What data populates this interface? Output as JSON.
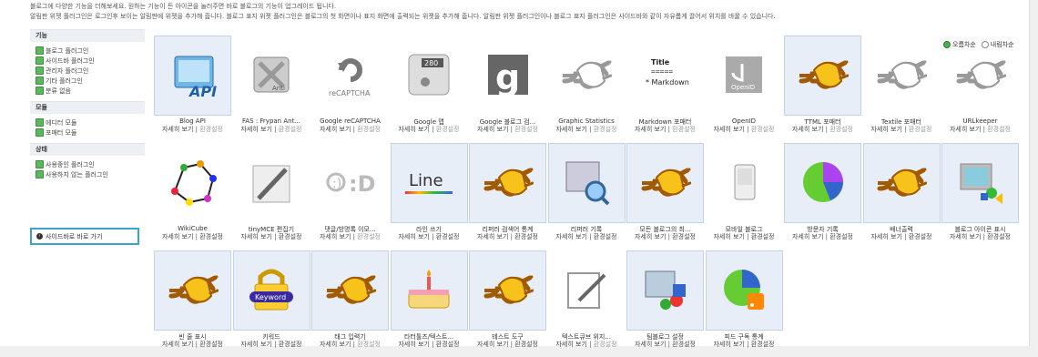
{
  "description": {
    "line1": "블로그에 다양한 기능을 더해보세요. 원하는 기능이 든 아이콘을 눌러주면 바로 블로그의 기능이 업그레이드 됩니다.",
    "line2": "알림판 위젯 플러그인은 로그인후 보이는 알림판에 위젯을 추가해 줍니다. 블로그 표지 위젯 플러그인은 블로그의 첫 화면이나 표지 화면에 출력되는 위젯을 추가해 줍니다. 알림판 위젯 플러그인이나 블로그 표지 플러그인은 사이드바와 같이 자유롭게 끌어서 위치를 바꿀 수 있습니다."
  },
  "sidebar": {
    "sections": [
      {
        "title": "기능",
        "items": [
          "블로그 플러그인",
          "사이드바 플러그인",
          "관리자 플러그인",
          "기타 플러그인",
          "분류 없음"
        ]
      },
      {
        "title": "모듈",
        "items": [
          "에디터 모듈",
          "포매터 모듈"
        ]
      },
      {
        "title": "상태",
        "items": [
          "사용중인 플러그인",
          "사용하지 않는 플러그인"
        ]
      }
    ],
    "jump_label": "사이드바로 바로 가기"
  },
  "sort": {
    "ascending": "오름차순",
    "descending": "내림차순",
    "selected": "ascending"
  },
  "action_labels": {
    "detail": "자세히 보기",
    "sep": " | ",
    "settings": "환경설정"
  },
  "plugins": [
    {
      "name": "Blog API",
      "icon": "api-icon",
      "active": true,
      "settings_active": false
    },
    {
      "name": "FAS : Frypan Ant...",
      "icon": "anti-spam-icon",
      "active": false,
      "settings_active": false
    },
    {
      "name": "Google reCAPTCHA",
      "icon": "recaptcha-icon",
      "caption": "reCAPTCHA",
      "active": false,
      "settings_active": false
    },
    {
      "name": "Google 맵",
      "icon": "google-map-icon",
      "caption": "280",
      "active": false,
      "settings_active": false
    },
    {
      "name": "Google 블로그 검...",
      "icon": "google-logo-icon",
      "active": false,
      "settings_active": false
    },
    {
      "name": "Graphic Statistics",
      "icon": "plug-icon-gray",
      "active": false,
      "settings_active": false
    },
    {
      "name": "Markdown 포매터",
      "icon": "markdown-icon",
      "md_title": "Title",
      "md_rule": "=====",
      "md_text": "* Markdown",
      "active": false,
      "settings_active": false
    },
    {
      "name": "OpenID",
      "icon": "openid-icon",
      "caption": "OpenID",
      "active": false,
      "settings_active": false
    },
    {
      "name": "TTML 포매터",
      "icon": "plug-icon-yellow",
      "active": true,
      "settings_active": false
    },
    {
      "name": "Textile 포매터",
      "icon": "plug-icon-gray",
      "active": false,
      "settings_active": false
    },
    {
      "name": "URLkeeper",
      "icon": "plug-icon-gray",
      "active": false,
      "settings_active": false
    },
    {
      "name": "WikiCube",
      "icon": "network-icon",
      "active": false,
      "settings_active": true
    },
    {
      "name": "tinyMCE 편집기",
      "icon": "pen-icon",
      "active": false,
      "settings_active": true
    },
    {
      "name": "댓글/방명록 이모...",
      "icon": "emoticon-icon",
      "active": false,
      "settings_active": false
    },
    {
      "name": "라인 쓰기",
      "icon": "line-icon",
      "caption": "Line",
      "active": true,
      "settings_active": true
    },
    {
      "name": "리퍼러 검색어 통계",
      "icon": "plug-icon-yellow",
      "active": true,
      "settings_active": true
    },
    {
      "name": "리퍼러 기록",
      "icon": "magnifier-icon",
      "active": true,
      "settings_active": true
    },
    {
      "name": "모든 블로그의 최...",
      "icon": "plug-icon-yellow",
      "active": true,
      "settings_active": true
    },
    {
      "name": "모바일 블로그",
      "icon": "mobile-icon",
      "active": false,
      "settings_active": true
    },
    {
      "name": "방문자 기록",
      "icon": "pie-icon",
      "active": true,
      "settings_active": true
    },
    {
      "name": "배너출력",
      "icon": "plug-icon-yellow",
      "active": true,
      "settings_active": true
    },
    {
      "name": "블로그 아이콘 표시",
      "icon": "monitor-icon",
      "active": true,
      "settings_active": true
    },
    {
      "name": "빈 줄 표시",
      "icon": "plug-icon-yellow",
      "active": true,
      "settings_active": true
    },
    {
      "name": "키워드",
      "icon": "keyword-lock-icon",
      "caption": "Keyword",
      "active": true,
      "settings_active": true
    },
    {
      "name": "태그 입력기",
      "icon": "plug-icon-yellow",
      "active": true,
      "settings_active": false
    },
    {
      "name": "타터툴즈/텍스트...",
      "icon": "cake-icon",
      "active": true,
      "settings_active": true
    },
    {
      "name": "테스트 도구",
      "icon": "plug-icon-yellow",
      "active": true,
      "settings_active": true
    },
    {
      "name": "텍스트큐브 위지...",
      "icon": "edit-icon",
      "active": false,
      "settings_active": false
    },
    {
      "name": "팀블로그 설정",
      "icon": "team-icon",
      "active": true,
      "settings_active": true
    },
    {
      "name": "피드 구독 통계",
      "icon": "rss-pie-icon",
      "active": true,
      "settings_active": true
    }
  ]
}
